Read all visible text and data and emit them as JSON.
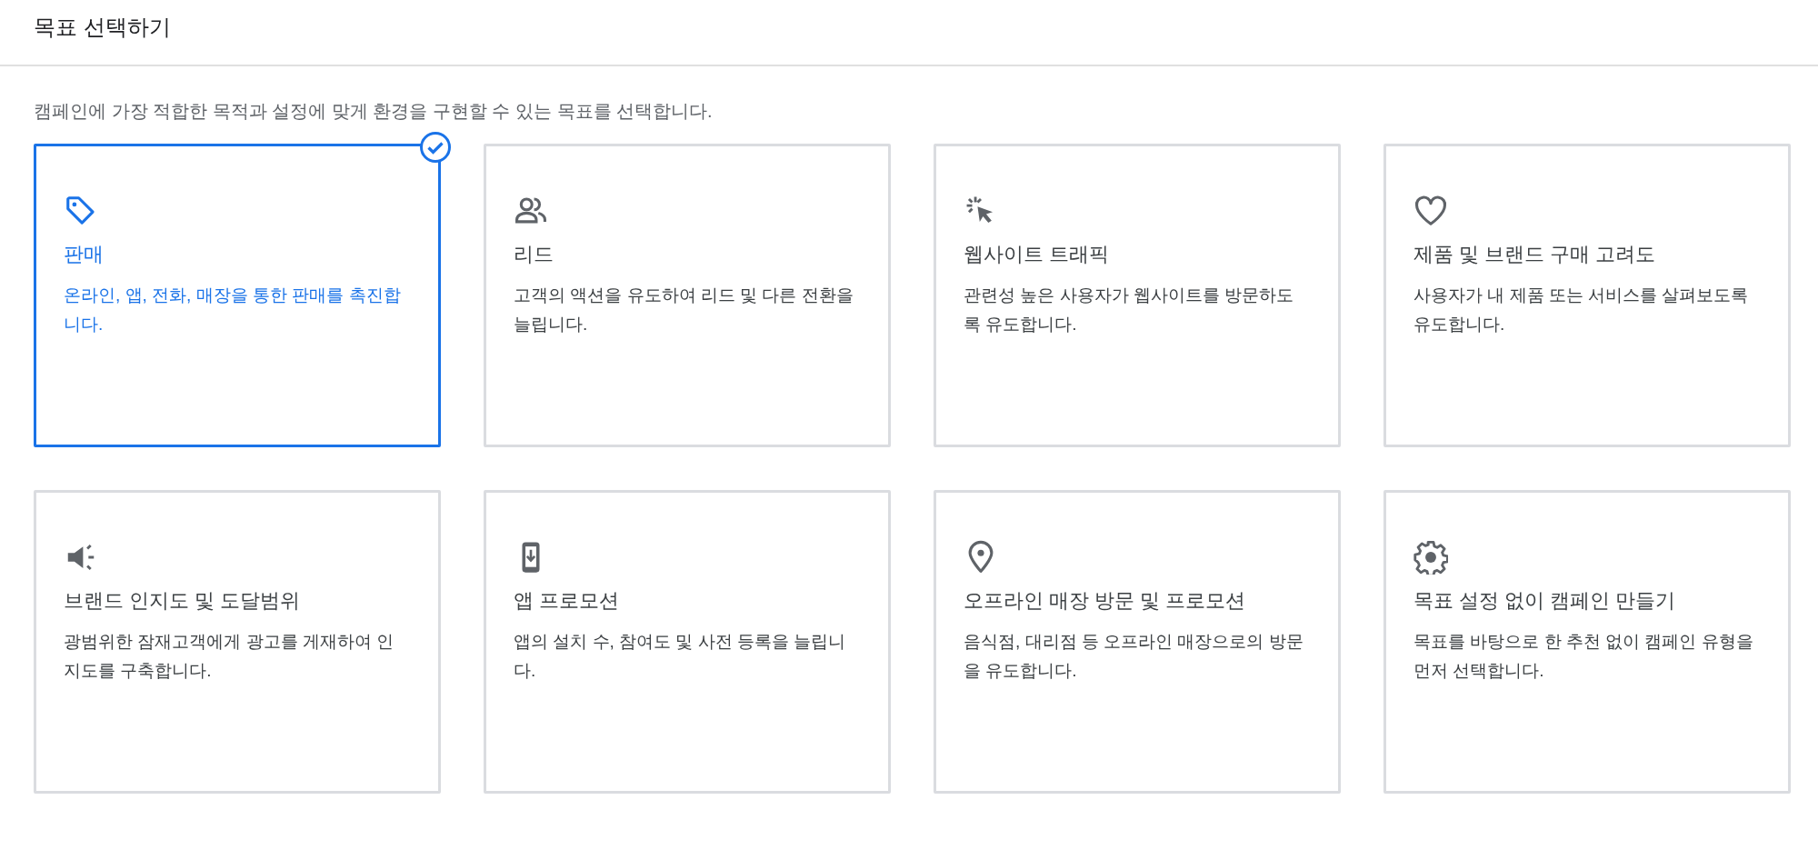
{
  "header": {
    "title": "목표 선택하기"
  },
  "intro": "캠페인에 가장 적합한 목적과 설정에 맞게 환경을 구현할 수 있는 목표를 선택합니다.",
  "goals": [
    {
      "title": "판매",
      "description": "온라인, 앱, 전화, 매장을 통한 판매를 촉진합니다.",
      "selected": true
    },
    {
      "title": "리드",
      "description": "고객의 액션을 유도하여 리드 및 다른 전환을 늘립니다.",
      "selected": false
    },
    {
      "title": "웹사이트 트래픽",
      "description": "관련성 높은 사용자가 웹사이트를 방문하도록 유도합니다.",
      "selected": false
    },
    {
      "title": "제품 및 브랜드 구매 고려도",
      "description": "사용자가 내 제품 또는 서비스를 살펴보도록 유도합니다.",
      "selected": false
    },
    {
      "title": "브랜드 인지도 및 도달범위",
      "description": "광범위한 잠재고객에게 광고를 게재하여 인지도를 구축합니다.",
      "selected": false
    },
    {
      "title": "앱 프로모션",
      "description": "앱의 설치 수, 참여도 및 사전 등록을 늘립니다.",
      "selected": false
    },
    {
      "title": "오프라인 매장 방문 및 프로모션",
      "description": "음식점, 대리점 등 오프라인 매장으로의 방문을 유도합니다.",
      "selected": false
    },
    {
      "title": "목표 설정 없이 캠페인 만들기",
      "description": "목표를 바탕으로 한 추천 없이 캠페인 유형을 먼저 선택합니다.",
      "selected": false
    }
  ]
}
